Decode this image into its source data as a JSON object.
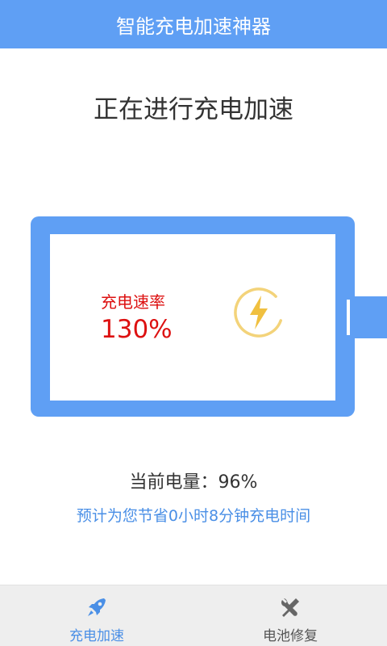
{
  "header": {
    "title": "智能充电加速神器"
  },
  "status": {
    "heading": "正在进行充电加速"
  },
  "battery": {
    "rate_label": "充电速率",
    "rate_value": "130%",
    "badge_icon": "lightning-bolt-icon"
  },
  "info": {
    "level_label": "当前电量：",
    "level_value": "96%",
    "estimate": "预计为您节省0小时8分钟充电时间"
  },
  "nav": {
    "items": [
      {
        "label": "充电加速",
        "icon": "rocket-icon",
        "active": true
      },
      {
        "label": "电池修复",
        "icon": "wrench-screwdriver-icon",
        "active": false
      }
    ]
  },
  "colors": {
    "accent": "#5f9ff4",
    "rate_text": "#dd1111",
    "estimate_text": "#4a8fe6",
    "bolt": "#f0c040"
  }
}
